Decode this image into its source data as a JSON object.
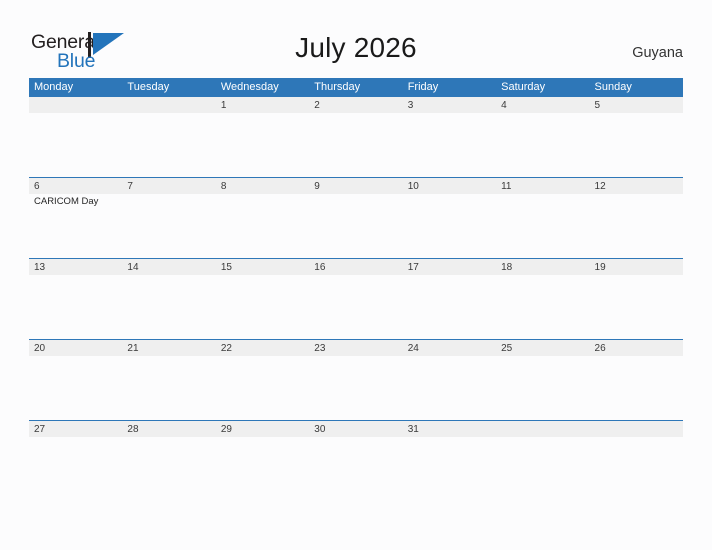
{
  "branding": {
    "logo_text_primary": "General",
    "logo_text_secondary": "Blue",
    "logo_flag_icon": "blue-flag-triangle-icon",
    "primary_color": "#2e77b8",
    "logo_blue": "#2374bb",
    "band_color": "#efefef",
    "page_background": "#fcfcfd"
  },
  "header": {
    "title": "July 2026",
    "country": "Guyana"
  },
  "calendar": {
    "month": "July",
    "year": "2026",
    "weekday_headers": [
      "Monday",
      "Tuesday",
      "Wednesday",
      "Thursday",
      "Friday",
      "Saturday",
      "Sunday"
    ],
    "weeks": [
      {
        "days": [
          {
            "num": "",
            "events": []
          },
          {
            "num": "",
            "events": []
          },
          {
            "num": "1",
            "events": []
          },
          {
            "num": "2",
            "events": []
          },
          {
            "num": "3",
            "events": []
          },
          {
            "num": "4",
            "events": []
          },
          {
            "num": "5",
            "events": []
          }
        ]
      },
      {
        "days": [
          {
            "num": "6",
            "events": [
              "CARICOM Day"
            ]
          },
          {
            "num": "7",
            "events": []
          },
          {
            "num": "8",
            "events": []
          },
          {
            "num": "9",
            "events": []
          },
          {
            "num": "10",
            "events": []
          },
          {
            "num": "11",
            "events": []
          },
          {
            "num": "12",
            "events": []
          }
        ]
      },
      {
        "days": [
          {
            "num": "13",
            "events": []
          },
          {
            "num": "14",
            "events": []
          },
          {
            "num": "15",
            "events": []
          },
          {
            "num": "16",
            "events": []
          },
          {
            "num": "17",
            "events": []
          },
          {
            "num": "18",
            "events": []
          },
          {
            "num": "19",
            "events": []
          }
        ]
      },
      {
        "days": [
          {
            "num": "20",
            "events": []
          },
          {
            "num": "21",
            "events": []
          },
          {
            "num": "22",
            "events": []
          },
          {
            "num": "23",
            "events": []
          },
          {
            "num": "24",
            "events": []
          },
          {
            "num": "25",
            "events": []
          },
          {
            "num": "26",
            "events": []
          }
        ]
      },
      {
        "days": [
          {
            "num": "27",
            "events": []
          },
          {
            "num": "28",
            "events": []
          },
          {
            "num": "29",
            "events": []
          },
          {
            "num": "30",
            "events": []
          },
          {
            "num": "31",
            "events": []
          },
          {
            "num": "",
            "events": []
          },
          {
            "num": "",
            "events": []
          }
        ]
      }
    ]
  }
}
